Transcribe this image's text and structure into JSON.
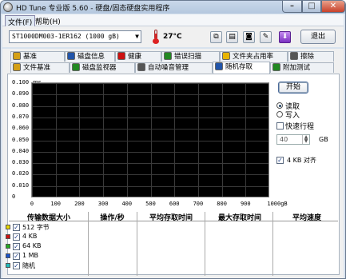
{
  "window": {
    "title": "HD Tune 专业版 5.60 - 硬盘/固态硬盘实用程序",
    "controls": {
      "minimize": "–",
      "maximize": "□",
      "close": "✕"
    }
  },
  "menubar": {
    "file": "文件(F)",
    "help": "帮助(H)"
  },
  "toolbar": {
    "drive": "ST1000DM003-1ER162 (1000 gB)",
    "temperature": "27°C",
    "exit_label": "退出",
    "icons": [
      "copy-icon",
      "paste-icon",
      "camera-icon",
      "options-icon",
      "download-icon"
    ]
  },
  "tabs_row1": [
    {
      "label": "基准",
      "icon": "benchmark-icon",
      "color": "#d4a017"
    },
    {
      "label": "磁盘信息",
      "icon": "info-icon",
      "color": "#2255aa"
    },
    {
      "label": "健康",
      "icon": "health-icon",
      "color": "#cc1111"
    },
    {
      "label": "错误扫描",
      "icon": "scan-icon",
      "color": "#228822"
    },
    {
      "label": "文件夹占用率",
      "icon": "folder-icon",
      "color": "#e8b400"
    },
    {
      "label": "擦除",
      "icon": "erase-icon",
      "color": "#555555"
    }
  ],
  "tabs_row2": [
    {
      "label": "文件基准",
      "icon": "file-benchmark-icon",
      "color": "#d4a017"
    },
    {
      "label": "磁盘监视器",
      "icon": "monitor-icon",
      "color": "#228822"
    },
    {
      "label": "自动噪音管理",
      "icon": "speaker-icon",
      "color": "#555555"
    },
    {
      "label": "随机存取",
      "icon": "random-access-icon",
      "color": "#2255aa"
    },
    {
      "label": "附加测试",
      "icon": "extra-tests-icon",
      "color": "#228822"
    }
  ],
  "controls": {
    "start_label": "开始",
    "read_label": "读取",
    "write_label": "写入",
    "short_stroke_label": "快速行程",
    "short_stroke_value": "40",
    "unit_label": "GB",
    "align_label": "4 KB 对齐"
  },
  "chart_data": {
    "type": "scatter",
    "ylabel": "ms",
    "xlabel": "gB",
    "yticks": [
      "0.100",
      "0.090",
      "0.080",
      "0.070",
      "0.060",
      "0.050",
      "0.040",
      "0.030",
      "0.020",
      "0.010",
      "0"
    ],
    "xticks": [
      "0",
      "100",
      "200",
      "300",
      "400",
      "500",
      "600",
      "700",
      "800",
      "900",
      "1000gB"
    ],
    "xlim": [
      0,
      1000
    ],
    "ylim": [
      0,
      0.1
    ],
    "grid": true,
    "series": []
  },
  "results_table": {
    "headers": [
      "传输数据大小",
      "操作/秒",
      "平均存取时间",
      "最大存取时间",
      "平均速度"
    ],
    "rows": [
      {
        "label": "512 字节",
        "color": "#e8d800"
      },
      {
        "label": "4 KB",
        "color": "#cc1111"
      },
      {
        "label": "64 KB",
        "color": "#22aa22"
      },
      {
        "label": "1 MB",
        "color": "#1a55cc"
      },
      {
        "label": "随机",
        "color": "#22bbbb"
      }
    ]
  }
}
